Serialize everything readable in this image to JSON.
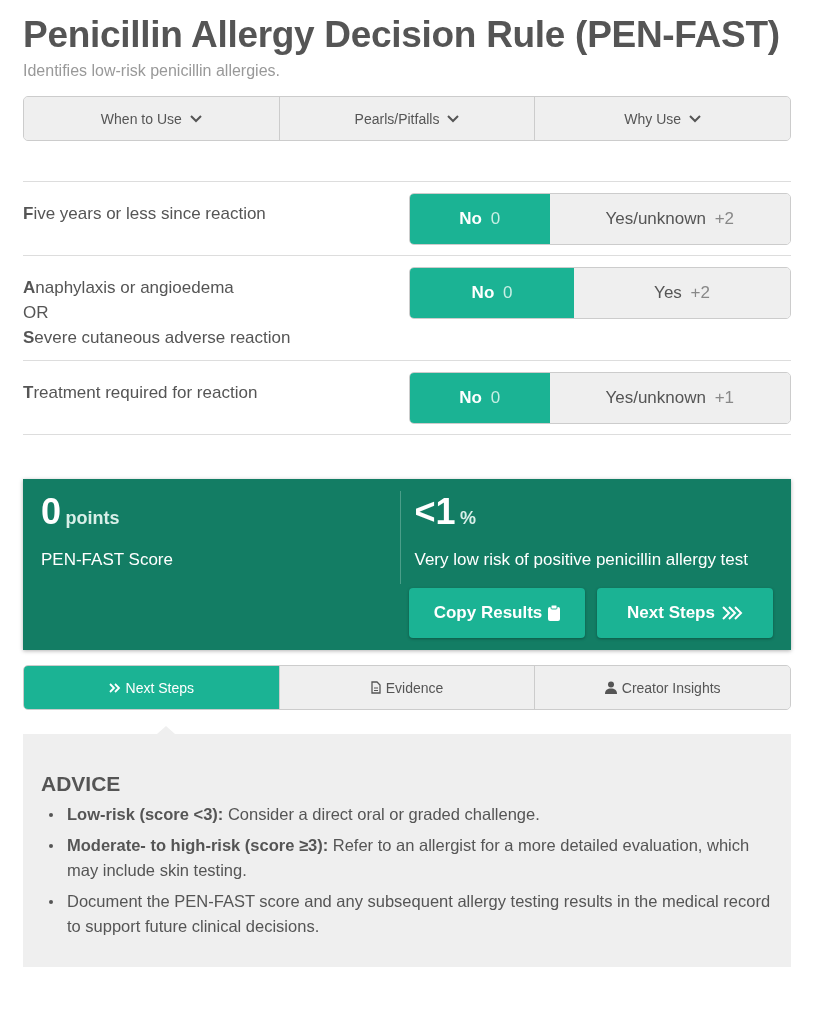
{
  "title": "Penicillin Allergy Decision Rule (PEN-FAST)",
  "subtitle": "Identifies low-risk penicillin allergies.",
  "info_tabs": [
    {
      "label": "When to Use"
    },
    {
      "label": "Pearls/Pitfalls"
    },
    {
      "label": "Why Use"
    }
  ],
  "questions": [
    {
      "label_lines": [
        "**F**ive years or less since reaction"
      ],
      "options": [
        {
          "label": "No",
          "points": "0",
          "selected": true
        },
        {
          "label": "Yes/unknown",
          "points": "+2",
          "selected": false
        }
      ]
    },
    {
      "label_lines": [
        "**A**naphylaxis or angioedema",
        "OR",
        "**S**evere cutaneous adverse reaction"
      ],
      "options": [
        {
          "label": "No",
          "points": "0",
          "selected": true
        },
        {
          "label": "Yes",
          "points": "+2",
          "selected": false
        }
      ]
    },
    {
      "label_lines": [
        "**T**reatment required for reaction"
      ],
      "options": [
        {
          "label": "No",
          "points": "0",
          "selected": true
        },
        {
          "label": "Yes/unknown",
          "points": "+1",
          "selected": false
        }
      ]
    }
  ],
  "result": {
    "score": "0",
    "score_unit": "points",
    "score_label": "PEN-FAST Score",
    "risk": "<1",
    "risk_unit": "%",
    "risk_text": "Very low risk of positive penicillin allergy test",
    "buttons": [
      "Copy Results",
      "Next Steps"
    ]
  },
  "bottom_tabs": [
    {
      "label": "Next Steps",
      "selected": true
    },
    {
      "label": "Evidence",
      "selected": false
    },
    {
      "label": "Creator Insights",
      "selected": false
    }
  ],
  "advice": {
    "heading": "ADVICE",
    "items": [
      "**Low-risk (score <3):** Consider a direct oral or graded challenge.",
      "**Moderate- to high-risk (score ≥3):** Refer to an allergist for a more detailed evaluation, which may include skin testing.",
      "Document the PEN-FAST score and any subsequent allergy testing results in the medical record to support future clinical decisions."
    ]
  }
}
